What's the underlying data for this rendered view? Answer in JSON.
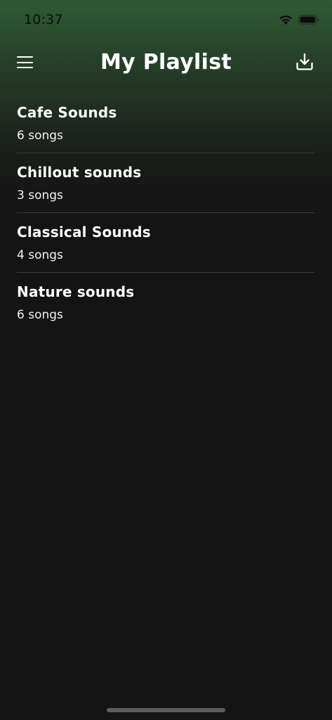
{
  "status_bar": {
    "time": "10:37",
    "icons": [
      "signal-icon",
      "wifi-icon",
      "battery-icon"
    ]
  },
  "header": {
    "title": "My Playlist",
    "left_icon": "menu-icon",
    "right_icon": "download-icon"
  },
  "playlists": [
    {
      "name": "Cafe Sounds",
      "count": "6 songs"
    },
    {
      "name": "Chillout sounds",
      "count": "3 songs"
    },
    {
      "name": "Classical Sounds",
      "count": "4 songs"
    },
    {
      "name": "Nature sounds",
      "count": "6 songs"
    }
  ],
  "colors": {
    "gradient_top": "#2f5a33",
    "background": "#141414",
    "text": "#ffffff",
    "divider": "#3a3a3a"
  }
}
